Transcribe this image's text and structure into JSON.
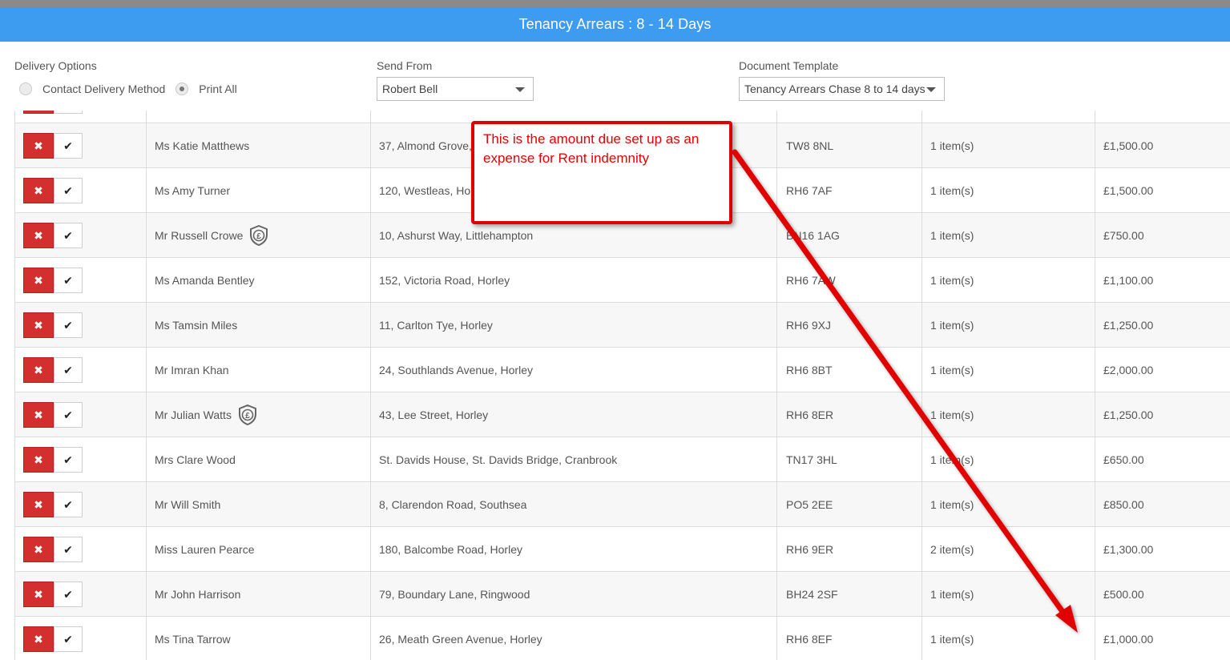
{
  "header": {
    "title": "Tenancy Arrears : 8 - 14 Days"
  },
  "delivery": {
    "label": "Delivery Options",
    "option_contact": "Contact Delivery Method",
    "option_print": "Print All",
    "selected": "Print All"
  },
  "send_from": {
    "label": "Send From",
    "value": "Robert Bell"
  },
  "template": {
    "label": "Document Template",
    "value": "Tenancy Arrears Chase 8 to 14 days"
  },
  "rows": [
    {
      "name": "Ms Katie Matthews",
      "address": "37, Almond Grove,",
      "postcode": "TW8 8NL",
      "items": "1 item(s)",
      "amount": "£1,500.00",
      "icon": ""
    },
    {
      "name": "Ms Amy Turner",
      "address": "120, Westleas, Hor",
      "postcode": "RH6 7AF",
      "items": "1 item(s)",
      "amount": "£1,500.00",
      "icon": ""
    },
    {
      "name": "Mr Russell Crowe",
      "address": "10, Ashurst Way, Littlehampton",
      "postcode": "BN16 1AG",
      "items": "1 item(s)",
      "amount": "£750.00",
      "icon": "shield-pound-icon"
    },
    {
      "name": "Ms Amanda Bentley",
      "address": "152, Victoria Road, Horley",
      "postcode": "RH6 7AW",
      "items": "1 item(s)",
      "amount": "£1,100.00",
      "icon": ""
    },
    {
      "name": "Ms Tamsin Miles",
      "address": "11, Carlton Tye, Horley",
      "postcode": "RH6 9XJ",
      "items": "1 item(s)",
      "amount": "£1,250.00",
      "icon": ""
    },
    {
      "name": "Mr Imran Khan",
      "address": "24, Southlands Avenue, Horley",
      "postcode": "RH6 8BT",
      "items": "1 item(s)",
      "amount": "£2,000.00",
      "icon": ""
    },
    {
      "name": "Mr Julian Watts",
      "address": "43, Lee Street, Horley",
      "postcode": "RH6 8ER",
      "items": "1 item(s)",
      "amount": "£1,250.00",
      "icon": "shield-pound-icon"
    },
    {
      "name": "Mrs Clare Wood",
      "address": "St. Davids House, St. Davids Bridge, Cranbrook",
      "postcode": "TN17 3HL",
      "items": "1 item(s)",
      "amount": "£650.00",
      "icon": ""
    },
    {
      "name": "Mr Will Smith",
      "address": "8, Clarendon Road, Southsea",
      "postcode": "PO5 2EE",
      "items": "1 item(s)",
      "amount": "£850.00",
      "icon": ""
    },
    {
      "name": "Miss Lauren Pearce",
      "address": "180, Balcombe Road, Horley",
      "postcode": "RH6 9ER",
      "items": "2 item(s)",
      "amount": "£1,300.00",
      "icon": ""
    },
    {
      "name": "Mr John Harrison",
      "address": "79, Boundary Lane, Ringwood",
      "postcode": "BH24 2SF",
      "items": "1 item(s)",
      "amount": "£500.00",
      "icon": ""
    },
    {
      "name": "Ms Tina Tarrow",
      "address": "26, Meath Green Avenue, Horley",
      "postcode": "RH6 8EF",
      "items": "1 item(s)",
      "amount": "£1,000.00",
      "icon": ""
    }
  ],
  "callout": {
    "text": "This is the amount due set up as an expense for Rent indemnity"
  },
  "colors": {
    "header": "#3d9bf0",
    "reject": "#d32f2f",
    "annotation": "#e10000"
  }
}
